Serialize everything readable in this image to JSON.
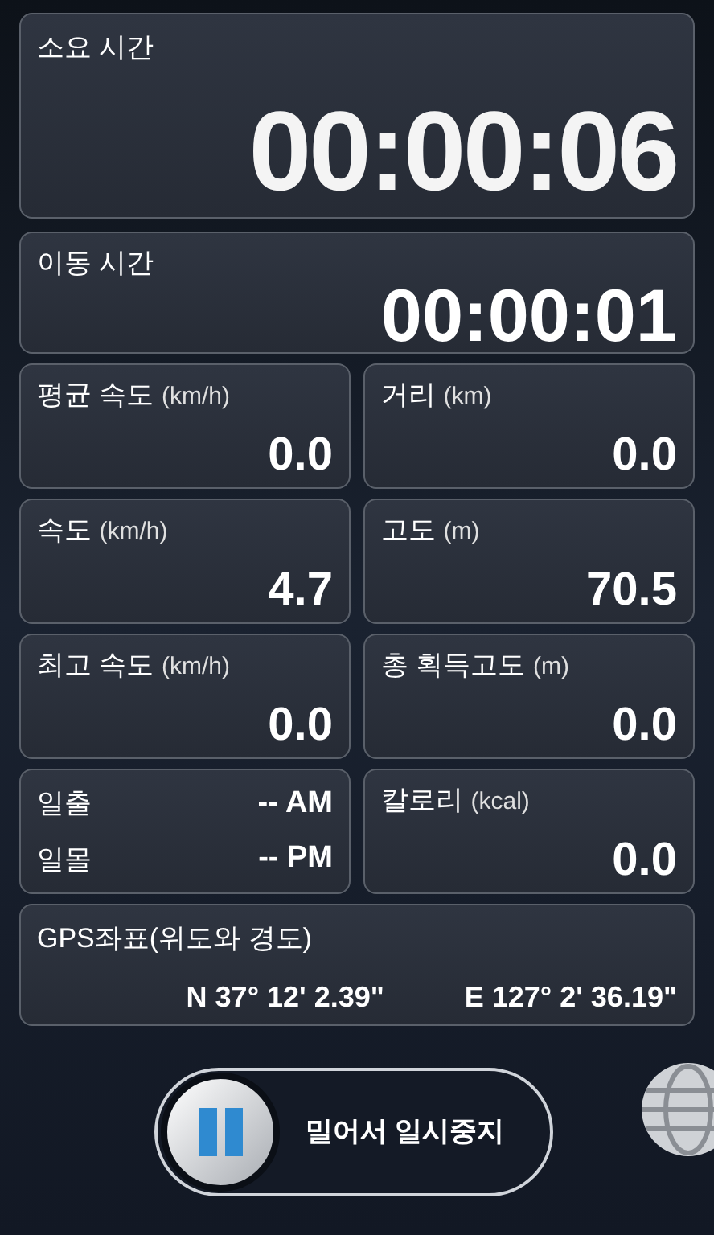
{
  "elapsed": {
    "label": "소요 시간",
    "value": "00:00:06"
  },
  "moving": {
    "label": "이동 시간",
    "value": "00:00:01"
  },
  "stats": [
    {
      "label": "평균 속도",
      "unit": "(km/h)",
      "value": "0.0"
    },
    {
      "label": "거리",
      "unit": "(km)",
      "value": "0.0"
    },
    {
      "label": "속도",
      "unit": "(km/h)",
      "value": "4.7"
    },
    {
      "label": "고도",
      "unit": "(m)",
      "value": "70.5"
    },
    {
      "label": "최고 속도",
      "unit": "(km/h)",
      "value": "0.0"
    },
    {
      "label": "총 획득고도",
      "unit": "(m)",
      "value": "0.0"
    }
  ],
  "sun": [
    {
      "label": "일출",
      "value": "-- AM"
    },
    {
      "label": "일몰",
      "value": "-- PM"
    }
  ],
  "calories": {
    "label": "칼로리",
    "unit": "(kcal)",
    "value": "0.0"
  },
  "gps": {
    "label": "GPS좌표(위도와 경도)",
    "latitude": "N 37° 12' 2.39\"",
    "longitude": "E 127° 2' 36.19\""
  },
  "slider": {
    "label": "밀어서 일시중지"
  }
}
